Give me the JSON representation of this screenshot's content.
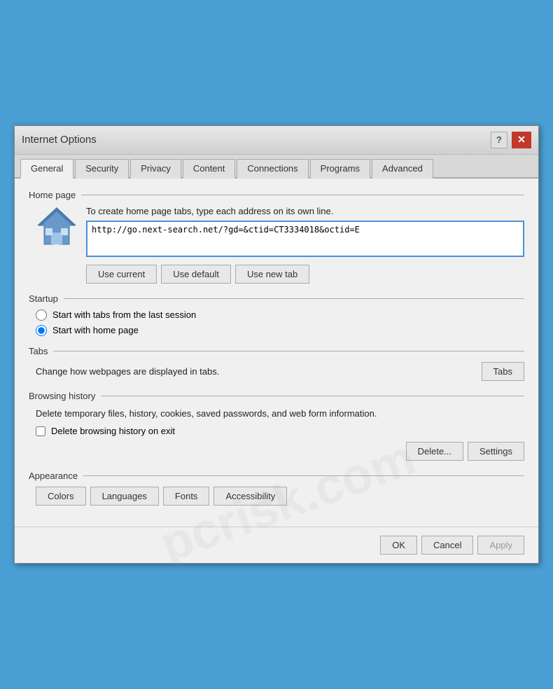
{
  "dialog": {
    "title": "Internet Options",
    "help_label": "?",
    "close_label": "✕"
  },
  "tabs": [
    {
      "label": "General",
      "active": true
    },
    {
      "label": "Security",
      "active": false
    },
    {
      "label": "Privacy",
      "active": false
    },
    {
      "label": "Content",
      "active": false
    },
    {
      "label": "Connections",
      "active": false
    },
    {
      "label": "Programs",
      "active": false
    },
    {
      "label": "Advanced",
      "active": false
    }
  ],
  "home_page": {
    "section_title": "Home page",
    "instruction": "To create home page tabs, type each address on its own line.",
    "url_value": "http://go.next-search.net/?gd=&ctid=CT3334018&octid=E",
    "btn_use_current": "Use current",
    "btn_use_default": "Use default",
    "btn_use_new_tab": "Use new tab"
  },
  "startup": {
    "section_title": "Startup",
    "option1": "Start with tabs from the last session",
    "option2": "Start with home page",
    "option2_selected": true
  },
  "tabs_section": {
    "section_title": "Tabs",
    "description": "Change how webpages are displayed in tabs.",
    "btn_label": "Tabs"
  },
  "browsing_history": {
    "section_title": "Browsing history",
    "description": "Delete temporary files, history, cookies, saved passwords, and web\nform information.",
    "checkbox_label": "Delete browsing history on exit",
    "checkbox_checked": false,
    "btn_delete": "Delete...",
    "btn_settings": "Settings"
  },
  "appearance": {
    "section_title": "Appearance",
    "btn_colors": "Colors",
    "btn_languages": "Languages",
    "btn_fonts": "Fonts",
    "btn_accessibility": "Accessibility"
  },
  "footer": {
    "btn_ok": "OK",
    "btn_cancel": "Cancel",
    "btn_apply": "Apply"
  }
}
